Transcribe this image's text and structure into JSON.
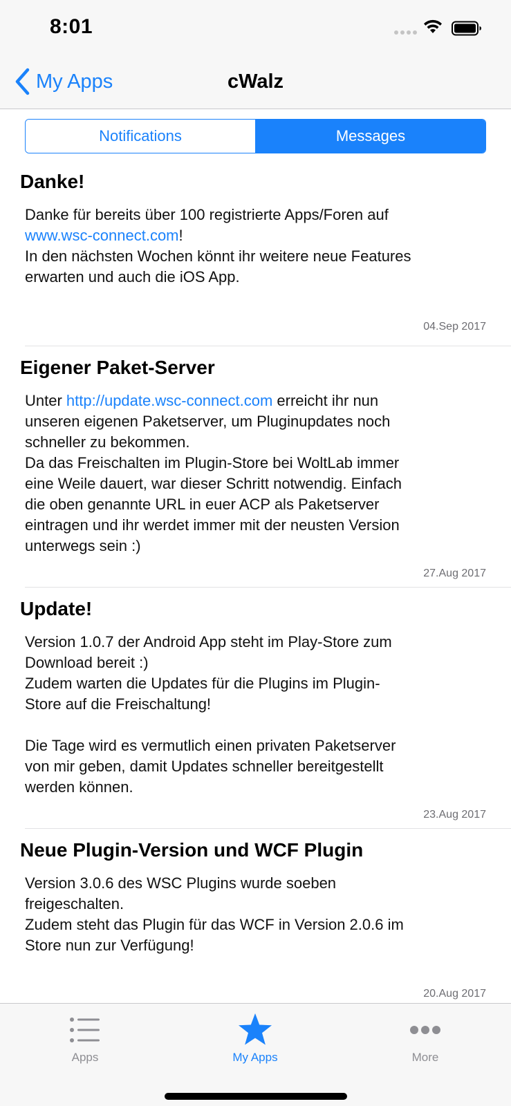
{
  "status_bar": {
    "time": "8:01"
  },
  "nav": {
    "back_label": "My Apps",
    "title": "cWalz"
  },
  "segments": {
    "notifications": "Notifications",
    "messages": "Messages",
    "selected": "messages"
  },
  "messages": [
    {
      "title": "Danke!",
      "lines": [
        [
          {
            "text": "Danke für bereits über 100 registrierte Apps/Foren auf"
          }
        ],
        [
          {
            "text": "www.wsc-connect.com",
            "link": true
          },
          {
            "text": "!"
          }
        ],
        [
          {
            "text": "In den nächsten Wochen könnt ihr weitere neue Features"
          }
        ],
        [
          {
            "text": "erwarten und auch die iOS App."
          }
        ],
        [
          {
            "text": ""
          }
        ]
      ],
      "date": "04.Sep 2017"
    },
    {
      "title": "Eigener Paket-Server",
      "lines": [
        [
          {
            "text": "Unter "
          },
          {
            "text": "http://update.wsc-connect.com",
            "link": true
          },
          {
            "text": " erreicht ihr nun"
          }
        ],
        [
          {
            "text": "unseren eigenen Paketserver, um Pluginupdates noch"
          }
        ],
        [
          {
            "text": "schneller zu bekommen."
          }
        ],
        [
          {
            "text": "Da das Freischalten im Plugin-Store bei WoltLab immer"
          }
        ],
        [
          {
            "text": "eine Weile dauert, war dieser Schritt notwendig. Einfach"
          }
        ],
        [
          {
            "text": "die oben genannte URL in euer ACP als Paketserver"
          }
        ],
        [
          {
            "text": "eintragen und ihr werdet immer mit der neusten Version"
          }
        ],
        [
          {
            "text": "unterwegs sein :)"
          }
        ]
      ],
      "date": "27.Aug 2017"
    },
    {
      "title": "Update!",
      "lines": [
        [
          {
            "text": "Version 1.0.7 der Android App steht im Play-Store zum"
          }
        ],
        [
          {
            "text": "Download bereit :)"
          }
        ],
        [
          {
            "text": "Zudem warten die Updates für die Plugins im Plugin-"
          }
        ],
        [
          {
            "text": "Store auf die Freischaltung!"
          }
        ],
        [
          {
            "text": ""
          }
        ],
        [
          {
            "text": "Die Tage wird es vermutlich einen privaten Paketserver"
          }
        ],
        [
          {
            "text": "von mir geben, damit Updates schneller bereitgestellt"
          }
        ],
        [
          {
            "text": "werden können."
          }
        ]
      ],
      "date": "23.Aug 2017"
    },
    {
      "title": "Neue Plugin-Version und WCF Plugin",
      "lines": [
        [
          {
            "text": "Version 3.0.6 des WSC Plugins wurde soeben"
          }
        ],
        [
          {
            "text": "freigeschalten."
          }
        ],
        [
          {
            "text": "Zudem steht das Plugin für das WCF in Version 2.0.6 im"
          }
        ],
        [
          {
            "text": "Store nun zur Verfügung!"
          }
        ],
        [
          {
            "text": ""
          }
        ]
      ],
      "date": "20.Aug 2017"
    }
  ],
  "tabs": [
    {
      "id": "apps",
      "label": "Apps",
      "icon": "list-icon"
    },
    {
      "id": "my-apps",
      "label": "My Apps",
      "icon": "star-icon",
      "selected": true
    },
    {
      "id": "more",
      "label": "More",
      "icon": "more-icon"
    }
  ],
  "colors": {
    "accent": "#1a82fb",
    "tab_inactive": "#8e8e93",
    "date": "#6d6d72"
  }
}
